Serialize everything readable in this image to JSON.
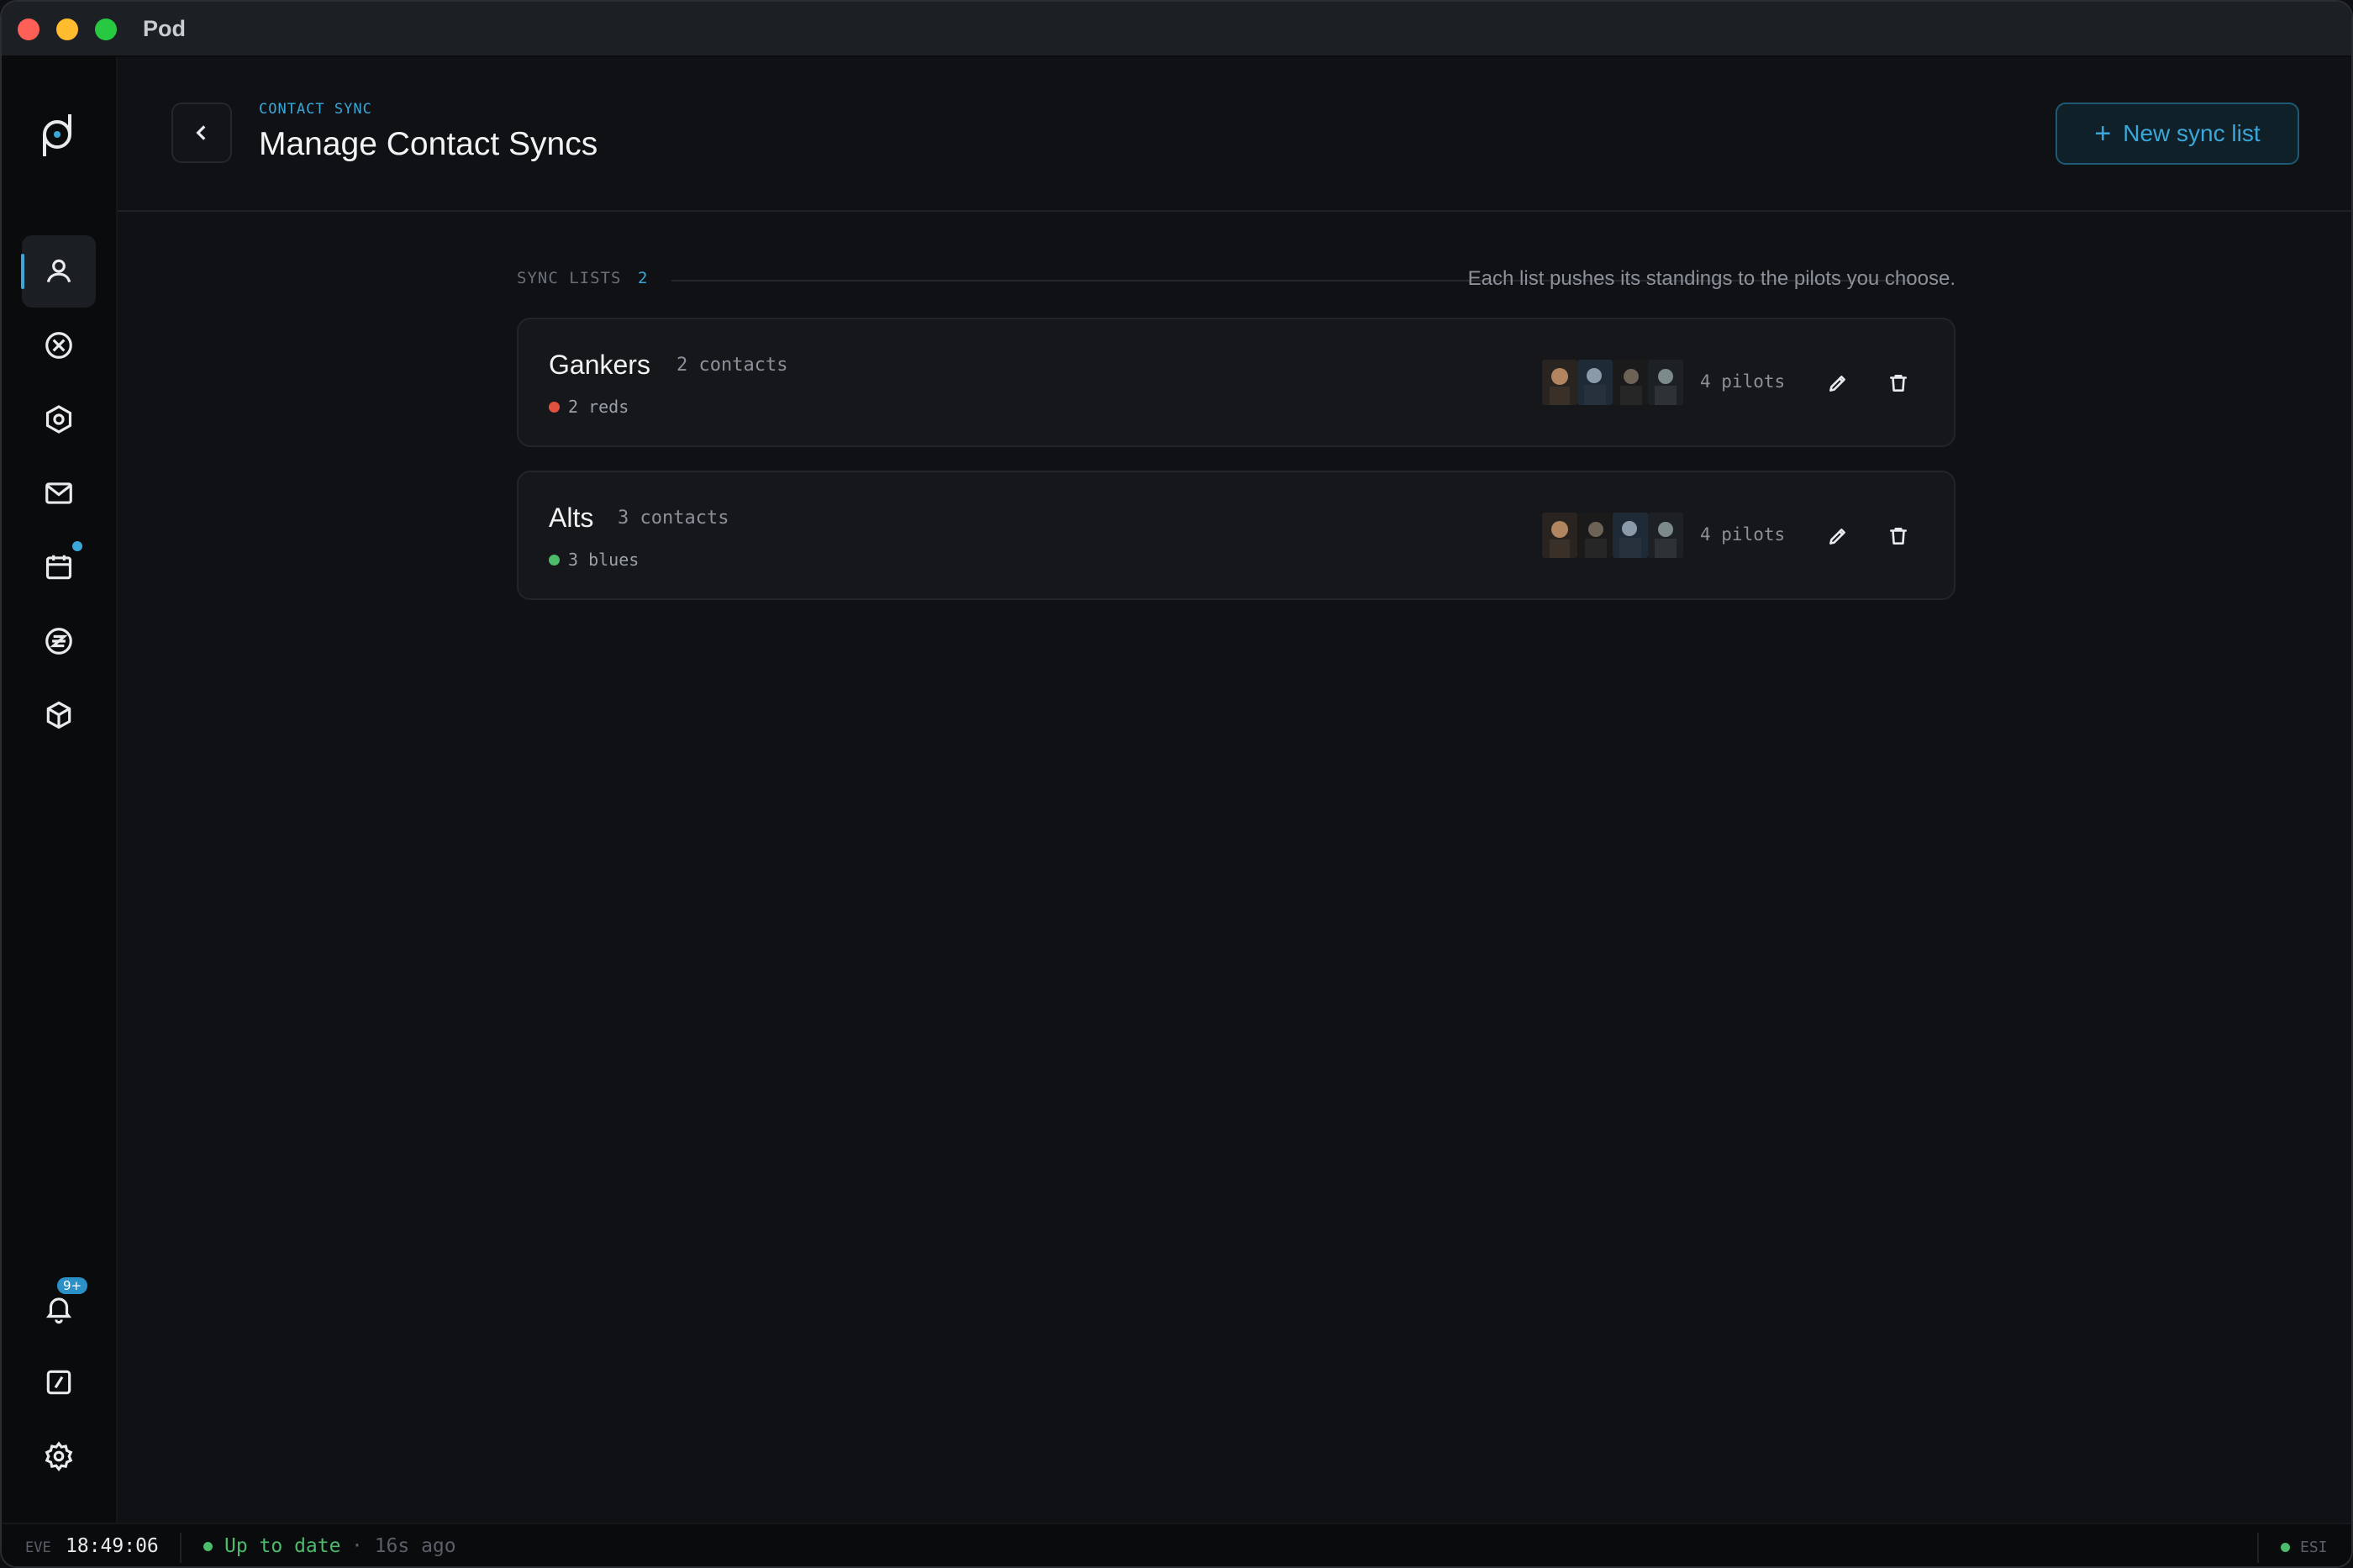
{
  "app": {
    "title": "Pod"
  },
  "header": {
    "eyebrow": "CONTACT SYNC",
    "title": "Manage Contact Syncs",
    "new_button_label": "New sync list"
  },
  "section": {
    "label": "SYNC LISTS",
    "count": "2",
    "hint": "Each list pushes its standings to the pilots you choose."
  },
  "lists": [
    {
      "name": "Gankers",
      "contacts": "2 contacts",
      "standing": "2 reds",
      "standing_color": "#e0523f",
      "pilots": "4 pilots"
    },
    {
      "name": "Alts",
      "contacts": "3 contacts",
      "standing": "3 blues",
      "standing_color": "#4cbb6b",
      "pilots": "4 pilots"
    }
  ],
  "sidebar": {
    "items": [
      {
        "icon": "person-icon",
        "active": true
      },
      {
        "icon": "circle-x-icon"
      },
      {
        "icon": "hexagon-icon"
      },
      {
        "icon": "mail-icon"
      },
      {
        "icon": "calendar-icon",
        "dot_badge": true
      },
      {
        "icon": "z-coin-icon"
      },
      {
        "icon": "cube-icon"
      }
    ],
    "bottom": [
      {
        "icon": "bell-icon",
        "badge": "9+"
      },
      {
        "icon": "slash-box-icon"
      },
      {
        "icon": "gear-icon"
      }
    ]
  },
  "statusbar": {
    "eve_label": "EVE",
    "time": "18:49:06",
    "status": "Up to date",
    "ago": "· 16s ago",
    "esi": "ESI"
  },
  "colors": {
    "accent": "#3aa7d8",
    "ok": "#4cbb6b",
    "red": "#e0523f"
  }
}
